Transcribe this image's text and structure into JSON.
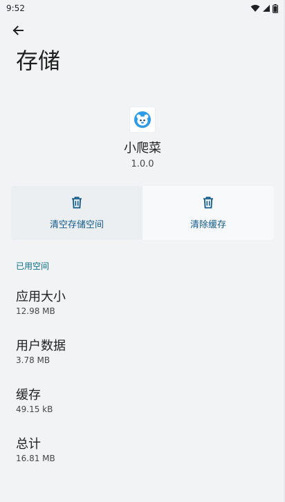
{
  "status_bar": {
    "time": "9:52",
    "icons": [
      "wifi-icon",
      "signal-icon",
      "battery-icon"
    ]
  },
  "header": {
    "back_icon": "arrow-left-icon",
    "title": "存储"
  },
  "app": {
    "icon": "app-mascot-icon",
    "name": "小爬菜",
    "version": "1.0.0"
  },
  "actions": {
    "clear_storage_label": "清空存储空间",
    "clear_cache_label": "清除缓存",
    "icon": "trash-icon"
  },
  "section": {
    "used_space_header": "已用空间"
  },
  "storage_items": [
    {
      "title": "应用大小",
      "value": "12.98 MB"
    },
    {
      "title": "用户数据",
      "value": "3.78 MB"
    },
    {
      "title": "缓存",
      "value": "49.15 kB"
    },
    {
      "title": "总计",
      "value": "16.81 MB"
    }
  ],
  "colors": {
    "background": "#f1f3f4",
    "accent": "#105a8a",
    "section_header": "#0b6e8a",
    "icon_blue": "#2c9be8"
  }
}
